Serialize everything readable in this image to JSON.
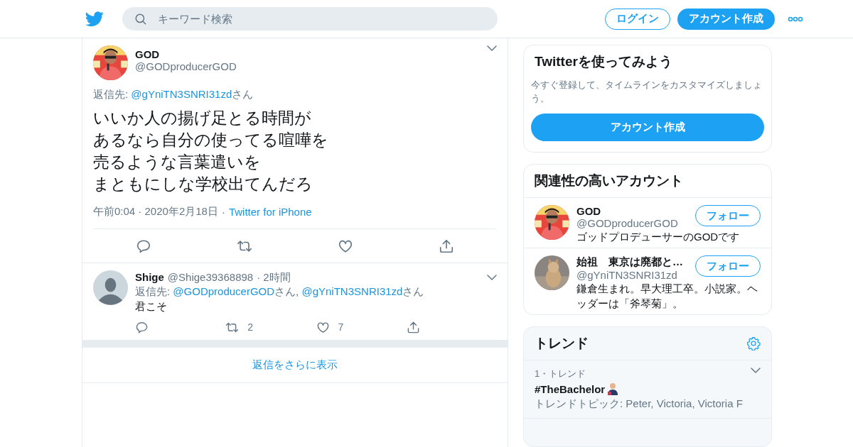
{
  "header": {
    "search": {
      "placeholder": "キーワード検索"
    },
    "login": "ログイン",
    "signup": "アカウント作成"
  },
  "tweet": {
    "name": "GOD",
    "handle": "@GODproducerGOD",
    "reply_prefix": "返信先: ",
    "reply_to": [
      {
        "handle": "@gYniTN3SNRI31zd",
        "suffix": "さん"
      }
    ],
    "lines": [
      "いいか人の揚げ足とる時間が",
      "あるなら自分の使ってる喧嘩を",
      "売るような言葉遣いを",
      "まともにしな学校出てんだろ"
    ],
    "time": "午前0:04 · 2020年2月18日",
    "separator": "·",
    "source": "Twitter for iPhone"
  },
  "replies": [
    {
      "name": "Shige",
      "handle": "@Shige39368898",
      "time": "· 2時間",
      "reply_prefix": "返信先: ",
      "reply_to": [
        {
          "handle": "@GODproducerGOD",
          "suffix": "さん, "
        },
        {
          "handle": "@gYniTN3SNRI31zd",
          "suffix": "さん"
        }
      ],
      "text": "君こそ",
      "retweets": "2",
      "likes": "7"
    }
  ],
  "show_more": "返信をさらに表示",
  "signup_card": {
    "title": "Twitterを使ってみよう",
    "text": "今すぐ登録して、タイムラインをカスタマイズしましょう。",
    "button": "アカウント作成"
  },
  "related": {
    "title": "関連性の高いアカウント",
    "accounts": [
      {
        "name": "GOD",
        "handle": "@GODproducerGOD",
        "bio": "ゴッドプロデューサーのGODです",
        "follow": "フォロー",
        "kind": "person"
      },
      {
        "name": "始祖　東京は廃都と…",
        "handle": "@gYniTN3SNRI31zd",
        "bio": "鎌倉生まれ。早大理工卒。小説家。ヘッダーは「斧琴菊」。",
        "follow": "フォロー",
        "kind": "cat"
      }
    ]
  },
  "trends": {
    "title": "トレンド",
    "items": [
      {
        "rank": "1・トレンド",
        "name": "#TheBachelor",
        "topics": "トレンドトピック: Peter, Victoria, Victoria F"
      }
    ]
  }
}
